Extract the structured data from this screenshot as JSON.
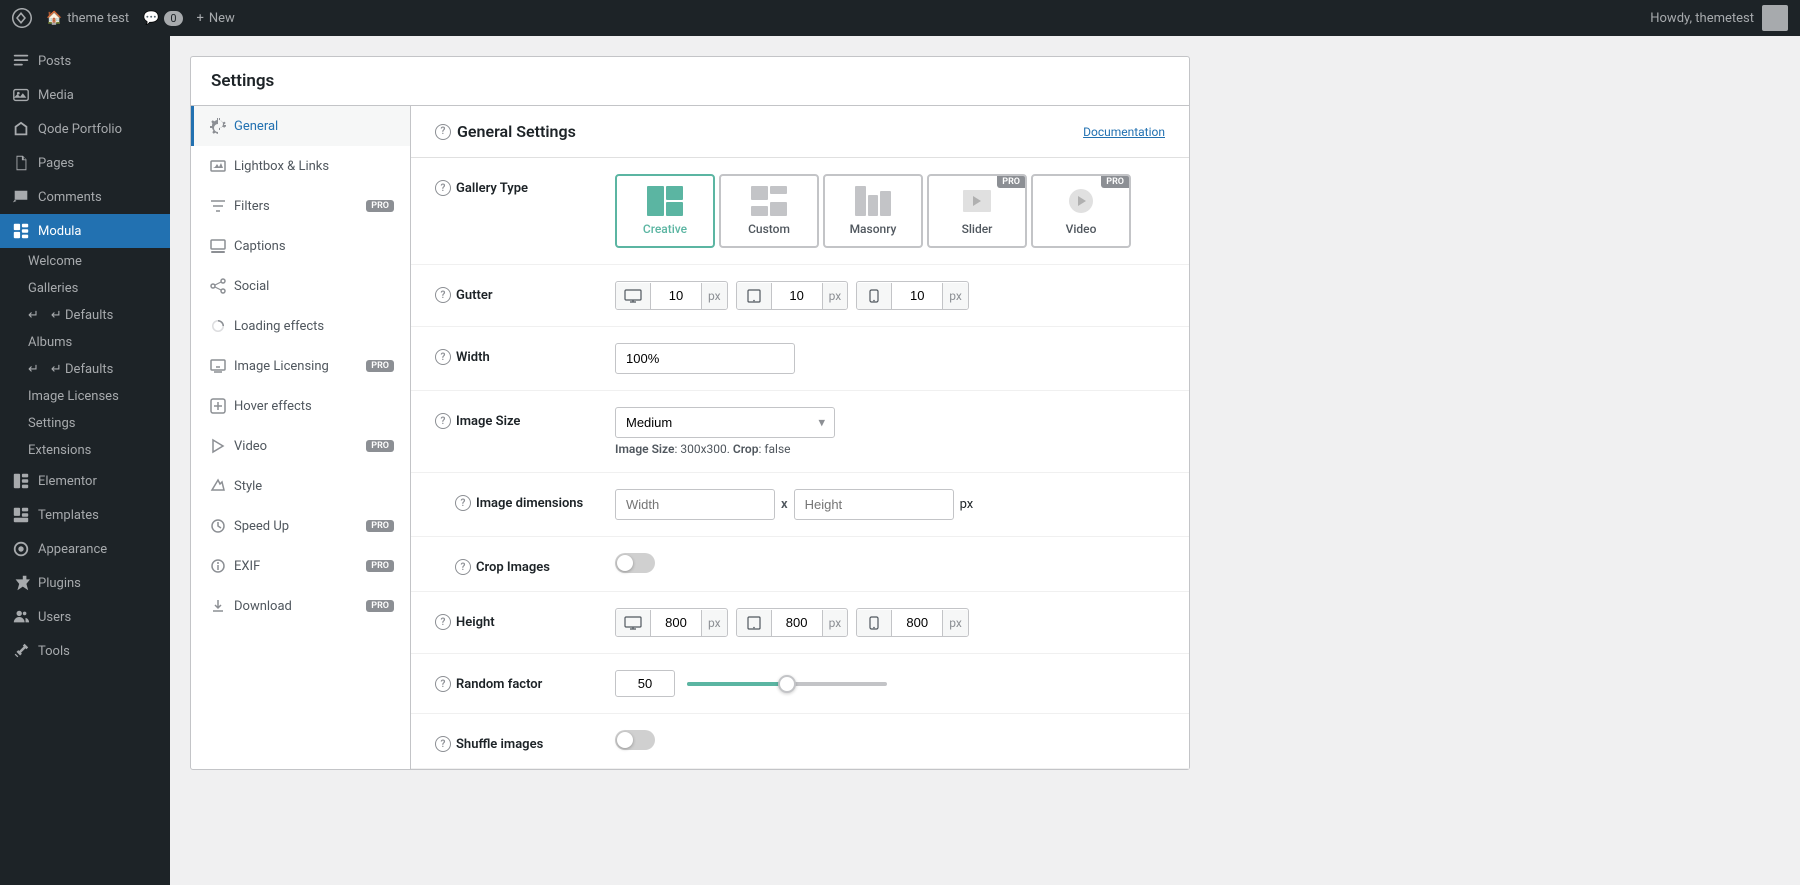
{
  "adminBar": {
    "siteName": "theme test",
    "commentCount": "0",
    "newLabel": "New",
    "userGreeting": "Howdy, themetest"
  },
  "sidebar": {
    "items": [
      {
        "id": "posts",
        "label": "Posts",
        "icon": "posts-icon"
      },
      {
        "id": "media",
        "label": "Media",
        "icon": "media-icon"
      },
      {
        "id": "qode-portfolio",
        "label": "Qode Portfolio",
        "icon": "qode-icon"
      },
      {
        "id": "pages",
        "label": "Pages",
        "icon": "pages-icon"
      },
      {
        "id": "comments",
        "label": "Comments",
        "icon": "comments-icon"
      },
      {
        "id": "modula",
        "label": "Modula",
        "icon": "modula-icon",
        "active": true
      },
      {
        "id": "elementor",
        "label": "Elementor",
        "icon": "elementor-icon"
      },
      {
        "id": "templates",
        "label": "Templates",
        "icon": "templates-icon"
      },
      {
        "id": "appearance",
        "label": "Appearance",
        "icon": "appearance-icon"
      },
      {
        "id": "plugins",
        "label": "Plugins",
        "icon": "plugins-icon"
      },
      {
        "id": "users",
        "label": "Users",
        "icon": "users-icon"
      },
      {
        "id": "tools",
        "label": "Tools",
        "icon": "tools-icon"
      }
    ],
    "modulaSubItems": [
      {
        "id": "welcome",
        "label": "Welcome"
      },
      {
        "id": "galleries",
        "label": "Galleries"
      },
      {
        "id": "defaults",
        "label": "↵ Defaults"
      },
      {
        "id": "albums",
        "label": "Albums"
      },
      {
        "id": "defaults2",
        "label": "↵ Defaults"
      },
      {
        "id": "image-licenses",
        "label": "Image Licenses"
      },
      {
        "id": "settings",
        "label": "Settings"
      },
      {
        "id": "extensions",
        "label": "Extensions"
      }
    ]
  },
  "settings": {
    "title": "Settings",
    "nav": [
      {
        "id": "general",
        "label": "General",
        "icon": "gear-icon",
        "active": true
      },
      {
        "id": "lightbox",
        "label": "Lightbox & Links",
        "icon": "lightbox-icon"
      },
      {
        "id": "filters",
        "label": "Filters",
        "icon": "filters-icon",
        "pro": true
      },
      {
        "id": "captions",
        "label": "Captions",
        "icon": "captions-icon"
      },
      {
        "id": "social",
        "label": "Social",
        "icon": "social-icon"
      },
      {
        "id": "loading-effects",
        "label": "Loading effects",
        "icon": "loading-icon"
      },
      {
        "id": "image-licensing",
        "label": "Image Licensing",
        "icon": "licensing-icon",
        "pro": true
      },
      {
        "id": "hover-effects",
        "label": "Hover effects",
        "icon": "hover-icon"
      },
      {
        "id": "video",
        "label": "Video",
        "icon": "video-icon",
        "pro": true
      },
      {
        "id": "style",
        "label": "Style",
        "icon": "style-icon"
      },
      {
        "id": "speed-up",
        "label": "Speed Up",
        "icon": "speed-icon",
        "pro": true
      },
      {
        "id": "exif",
        "label": "EXIF",
        "icon": "exif-icon",
        "pro": true
      },
      {
        "id": "download",
        "label": "Download",
        "icon": "download-icon",
        "pro": true
      }
    ],
    "content": {
      "sectionTitle": "General Settings",
      "documentationLabel": "Documentation",
      "fields": {
        "galleryType": {
          "label": "Gallery Type",
          "options": [
            {
              "id": "creative",
              "label": "Creative",
              "active": true,
              "pro": false
            },
            {
              "id": "custom",
              "label": "Custom",
              "active": false,
              "pro": false
            },
            {
              "id": "masonry",
              "label": "Masonry",
              "active": false,
              "pro": false
            },
            {
              "id": "slider",
              "label": "Slider",
              "active": false,
              "pro": true
            },
            {
              "id": "video",
              "label": "Video",
              "active": false,
              "pro": true
            }
          ]
        },
        "gutter": {
          "label": "Gutter",
          "desktop": "10",
          "tablet": "10",
          "mobile": "10",
          "unit": "px"
        },
        "width": {
          "label": "Width",
          "value": "100%",
          "placeholder": "100%"
        },
        "imageSize": {
          "label": "Image Size",
          "value": "Medium",
          "hint": "Image Size: 300x300. Crop: false"
        },
        "imageDimensions": {
          "label": "Image dimensions",
          "widthPlaceholder": "Width",
          "heightPlaceholder": "Height",
          "unit": "px"
        },
        "cropImages": {
          "label": "Crop Images",
          "enabled": false
        },
        "height": {
          "label": "Height",
          "desktop": "800",
          "tablet": "800",
          "mobile": "800",
          "unit": "px"
        },
        "randomFactor": {
          "label": "Random factor",
          "value": "50",
          "min": "0",
          "max": "100",
          "percent": 50
        },
        "shuffleImages": {
          "label": "Shuffle images",
          "enabled": false
        }
      }
    }
  },
  "probadge": "PRO"
}
